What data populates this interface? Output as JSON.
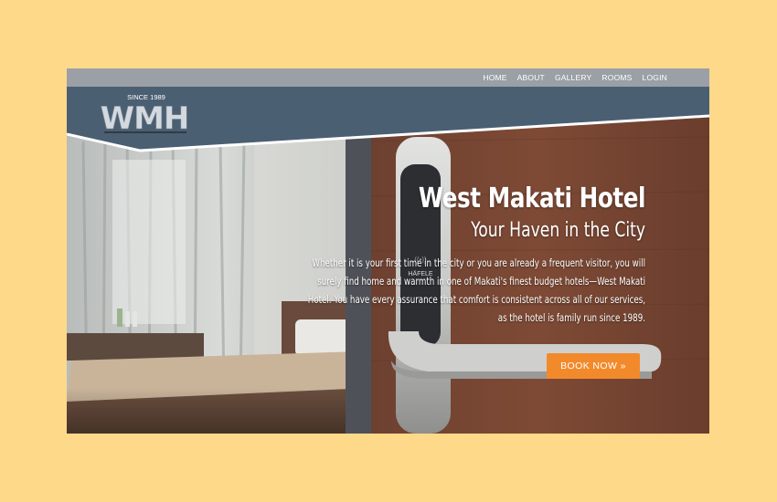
{
  "nav": {
    "items": [
      "HOME",
      "ABOUT",
      "GALLERY",
      "ROOMS",
      "LOGIN"
    ]
  },
  "logo": {
    "text": "WMH",
    "tagline": "SINCE 1989"
  },
  "hero": {
    "title": "West Makati Hotel",
    "subtitle": "Your Haven in the City",
    "body": "Whether it is your first time in the city or you are already a frequent visitor, you will surely find home and warmth in one of Makati's finest budget hotels—West Makati Hotel. You have every assurance that comfort is consistent across all of our services, as the hotel is family run since 1989.",
    "cta_label": "BOOK NOW »"
  },
  "lock": {
    "brand": "HÄFELE"
  },
  "colors": {
    "page_background": "#ffd98a",
    "header_band": "#4b5f73",
    "top_bar": "#9aa0a6",
    "cta": "#f28a2c"
  }
}
